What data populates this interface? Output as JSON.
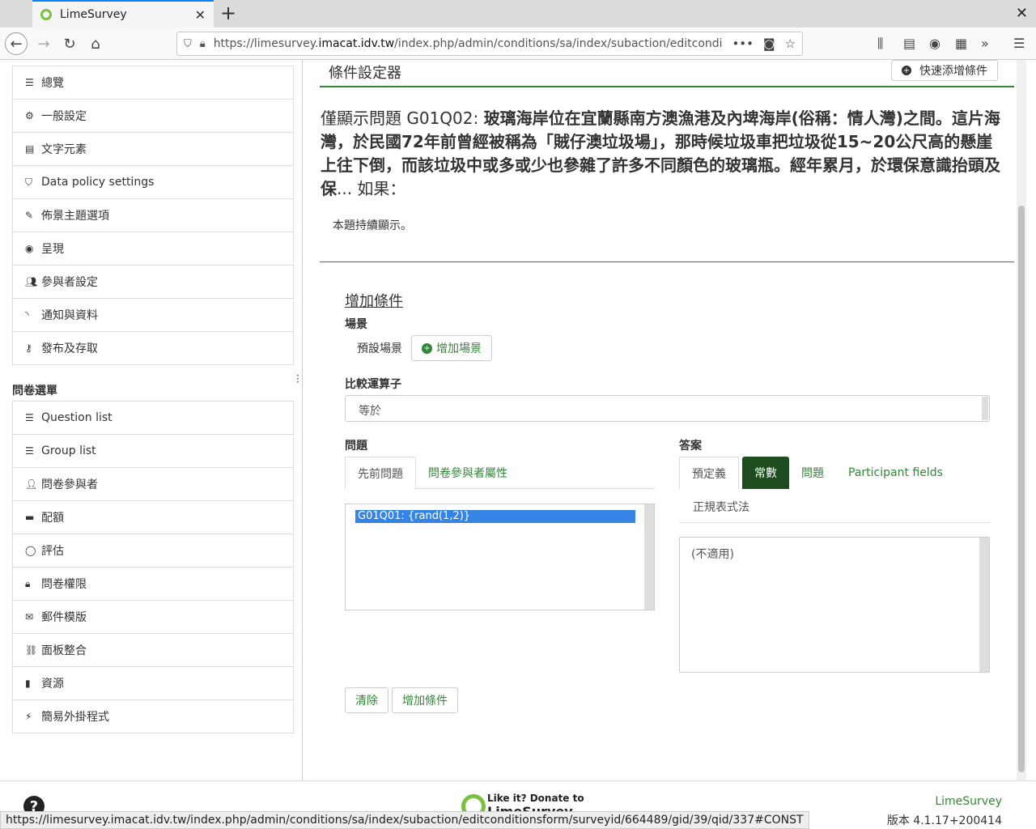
{
  "browser": {
    "tab_title": "LimeSurvey",
    "url_prefix": "https://limesurvey.",
    "url_domain": "imacat.idv.tw",
    "url_path": "/index.php/admin/conditions/sa/index/subaction/editconditionsf",
    "status_url": "https://limesurvey.imacat.idv.tw/index.php/admin/conditions/sa/index/subaction/editconditionsform/surveyid/664489/gid/39/qid/337#CONST"
  },
  "sidebar": {
    "settings_items": [
      {
        "label": "總覽",
        "icon": "list-icon"
      },
      {
        "label": "一般設定",
        "icon": "cogs-icon"
      },
      {
        "label": "文字元素",
        "icon": "file-text-icon"
      },
      {
        "label": "Data policy settings",
        "icon": "shield-icon"
      },
      {
        "label": "佈景主題選項",
        "icon": "paint-brush-icon"
      },
      {
        "label": "呈現",
        "icon": "eye-slash-icon"
      },
      {
        "label": "參與者設定",
        "icon": "users-icon"
      },
      {
        "label": "通知與資料",
        "icon": "rss-icon"
      },
      {
        "label": "發布及存取",
        "icon": "key-icon"
      }
    ],
    "menu_heading": "問卷選單",
    "menu_items": [
      {
        "label": "Question list",
        "icon": "list-icon"
      },
      {
        "label": "Group list",
        "icon": "list-icon"
      },
      {
        "label": "問卷參與者",
        "icon": "user-icon"
      },
      {
        "label": "配額",
        "icon": "tasks-icon"
      },
      {
        "label": "評估",
        "icon": "comment-icon"
      },
      {
        "label": "問卷權限",
        "icon": "lock-icon"
      },
      {
        "label": "郵件模版",
        "icon": "envelope-icon"
      },
      {
        "label": "面板整合",
        "icon": "link-icon"
      },
      {
        "label": "資源",
        "icon": "file-icon"
      },
      {
        "label": "簡易外掛程式",
        "icon": "plug-icon"
      }
    ]
  },
  "main": {
    "panel_title": "條件設定器",
    "quick_add": "快速添增條件",
    "qdesc_prefix": "僅顯示問題 G01Q02: ",
    "qdesc_bold": "玻璃海岸位在宜蘭縣南方澳漁港及內埤海岸(俗稱：情人灣)之間。這片海灣，於民國72年前曾經被稱為「賊仔澳垃圾場」，那時候垃圾車把垃圾從15~20公尺高的懸崖上往下倒，而該垃圾中或多或少也參雜了許多不同顏色的玻璃瓶。經年累月，於環保意識抬頭及保",
    "qdesc_suffix": "... 如果：",
    "always_shown": "本題持續顯示。",
    "add_condition_title": "增加條件",
    "scenario_label": "場景",
    "default_scenario": "預設場景",
    "add_scenario": "增加場景",
    "operator_label": "比較運算子",
    "operator_value": "等於",
    "question_label": "問題",
    "question_tabs": [
      "先前問題",
      "問卷參與者屬性"
    ],
    "question_option": "G01Q01: {rand(1,2)}",
    "answer_label": "答案",
    "answer_tabs": [
      "預定義",
      "常數",
      "問題",
      "Participant fields"
    ],
    "answer_tab_regex": "正規表式法",
    "answer_textarea": "(不適用)",
    "clear_button": "清除",
    "add_condition_button": "增加條件"
  },
  "footer": {
    "donate_line1": "Like it? Donate to",
    "donate_line2": "LimeSurvey",
    "app_name": "LimeSurvey",
    "version": "版本 4.1.17+200414"
  },
  "colors": {
    "accent": "#328637",
    "active_tab": "#1d4d1e",
    "selection": "#3584e4"
  }
}
